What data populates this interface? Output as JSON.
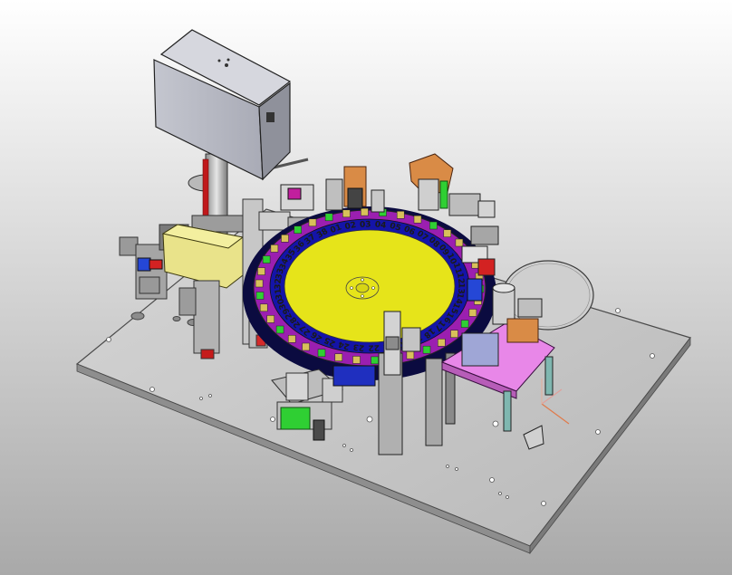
{
  "scene": {
    "subject": "rotary-indexing-assembly-machine",
    "dial_numbers": [
      "01",
      "02",
      "03",
      "04",
      "05",
      "06",
      "07",
      "08",
      "09",
      "10",
      "11",
      "12",
      "13",
      "14",
      "15",
      "16",
      "17",
      "18",
      "19",
      "20",
      "21",
      "22",
      "23",
      "24",
      "25",
      "26",
      "27",
      "28",
      "29",
      "30",
      "31",
      "32",
      "33",
      "34",
      "35",
      "36",
      "37",
      "38"
    ]
  },
  "colors": {
    "background_top": "#ffffff",
    "background_bottom": "#a9a9a9",
    "base_plate": "#c9c9c9",
    "dial_outer": "#9b1fb0",
    "dial_ring": "#1414a8",
    "dial_center": "#e6e41a",
    "pad": "#e887e8",
    "yellow_box": "#e9e38a",
    "green": "#2fcf33",
    "orange": "#d98b46"
  }
}
